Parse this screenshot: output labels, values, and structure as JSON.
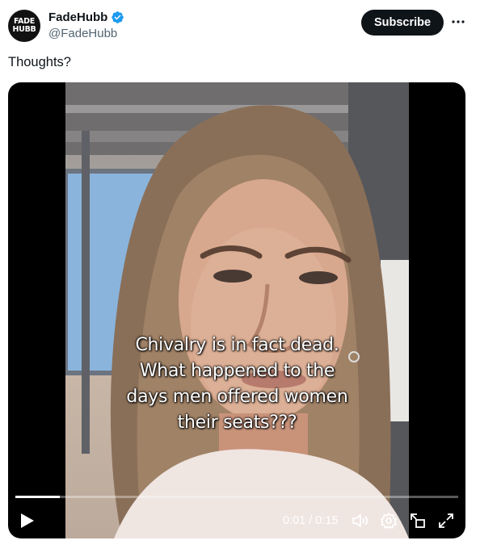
{
  "author": {
    "display_name": "FadeHubb",
    "handle": "@FadeHubb",
    "avatar_line1": "FADE",
    "avatar_line2": "HUBB"
  },
  "actions": {
    "subscribe_label": "Subscribe"
  },
  "tweet": {
    "text": "Thoughts?"
  },
  "video": {
    "caption_lines": [
      "Chivalry is in fact dead.",
      "What happened to the",
      "days men offered women",
      "their seats???"
    ],
    "current_time": "0:01",
    "duration": "0:15",
    "time_display": "0:01 / 0:15",
    "progress": 0.1
  },
  "icons": {
    "verified": "verified-badge-icon",
    "more": "more-dots-icon",
    "play": "play-icon",
    "volume": "volume-icon",
    "settings": "settings-icon",
    "pip": "pip-icon",
    "fullscreen": "fullscreen-icon"
  },
  "colors": {
    "verified_blue": "#1d9bf0",
    "subscribe_bg": "#0f1419",
    "handle_gray": "#536471"
  }
}
